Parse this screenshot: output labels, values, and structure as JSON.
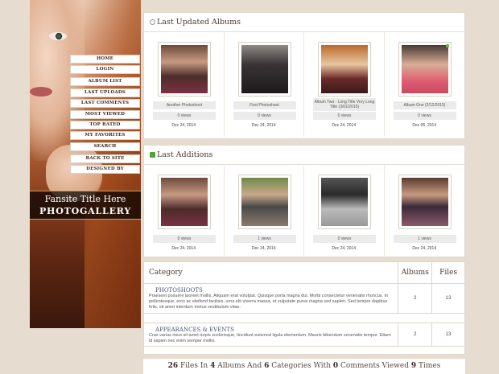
{
  "sidebar": {
    "menu": [
      "HOME",
      "LOGIN",
      "ALBUM LIST",
      "LAST UPLOADS",
      "LAST COMMENTS",
      "MOST VIEWED",
      "TOP RATED",
      "MY FAVORITES",
      "SEARCH",
      "BACK TO SITE",
      "DESIGNED BY"
    ],
    "site_title": "Fansite Title Here",
    "gallery_title": "PHOTOGALLERY"
  },
  "last_updated": {
    "title": "Last Updated Albums",
    "items": [
      {
        "name": "Another Photoshoot",
        "views": "0 views",
        "date": "Dec 24, 2014"
      },
      {
        "name": "First Photoshoot",
        "views": "0 views",
        "date": "Dec 24, 2014"
      },
      {
        "name": "Album Two - Long Title Very Long Title (3/01/2015)",
        "views": "0 views",
        "date": "Dec 24, 2014"
      },
      {
        "name": "Album One (2/12/2015)",
        "views": "0 views",
        "date": "Dec 06, 2014"
      }
    ]
  },
  "last_additions": {
    "title": "Last Additions",
    "items": [
      {
        "views": "0 views",
        "date": "Dec 24, 2014"
      },
      {
        "views": "1 views",
        "date": "Dec 24, 2014"
      },
      {
        "views": "0 views",
        "date": "Dec 24, 2014"
      },
      {
        "views": "1 views",
        "date": "Dec 24, 2014"
      }
    ]
  },
  "categories": {
    "headers": {
      "category": "Category",
      "albums": "Albums",
      "files": "Files"
    },
    "rows": [
      {
        "name": "PHOTOSHOOTS",
        "desc": "Praesent posuere laoreet mollis. Aliquam erat volutpat. Quisque porta magna dui. Morbi consectetur venenatis rhoncus. In pellentesque, eros ac eleifend facilisis, urna elit viverra massa, et vulputate purus magna sed sapien. Sed tempor dapibus felis, sit amet interdum metus vestibulum vitae.",
        "albums": "2",
        "files": "13"
      },
      {
        "name": "APPEARANCES & EVENTS",
        "desc": "Cras varius risus sit amet turpis scelerisque, tincidunt euismod ligula elementum. Mauris bibendum venenatis tempor. Etiam id sapien nec enim semper mollis.",
        "albums": "2",
        "files": "13"
      }
    ]
  },
  "stats": {
    "files": "26",
    "files_label": "Files In",
    "albums": "4",
    "albums_label": "Albums And",
    "categories": "6",
    "categories_label": "Categories With",
    "comments": "0",
    "comments_label": "Comments Viewed",
    "times": "9",
    "times_label": "Times"
  },
  "colors": {
    "background": "#e6dccf",
    "panel": "#ffffff",
    "chip": "#ebebeb"
  }
}
